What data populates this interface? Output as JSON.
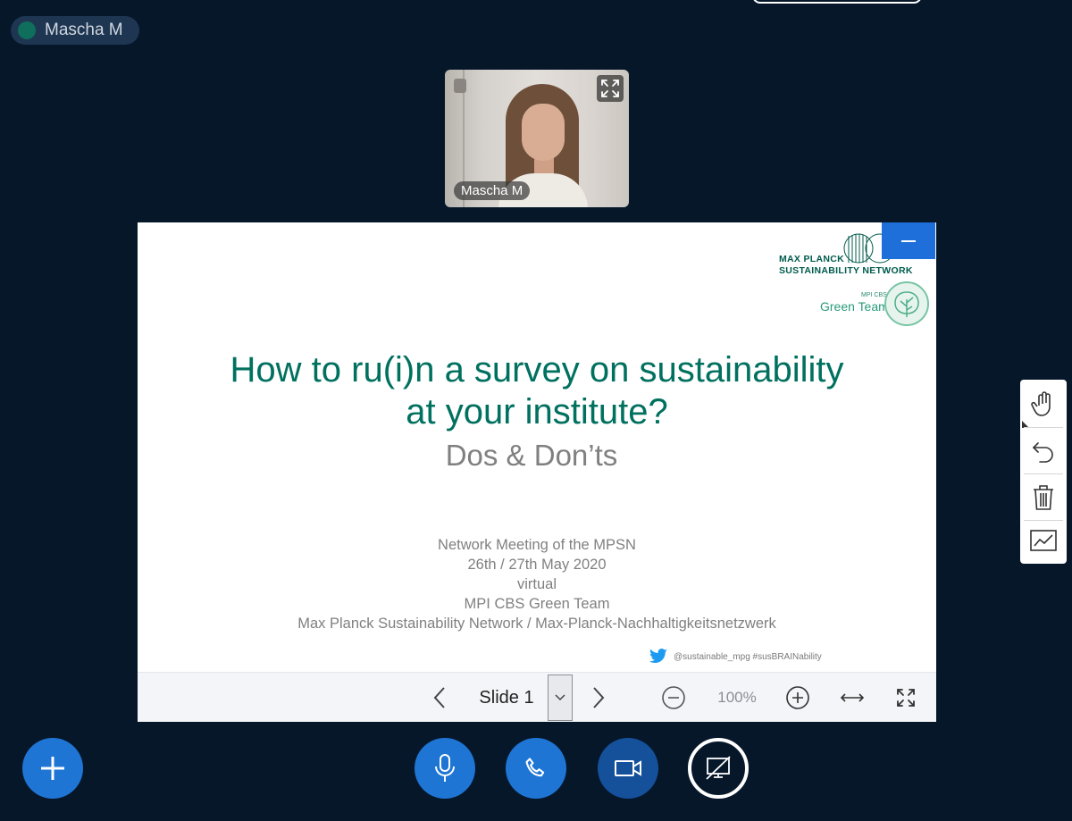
{
  "header": {
    "user_pill_name": "Mascha M"
  },
  "webcam": {
    "label": "Mascha M",
    "expand_icon": "expand-arrows-icon"
  },
  "slide": {
    "logo_line1": "MAX PLANCK",
    "logo_line2": "SUSTAINABILITY NETWORK",
    "green_team_small": "MPI CBS",
    "green_team": "Green Team",
    "title_line1": "How to ru(i)n a survey on sustainability",
    "title_line2": "at your institute?",
    "subtitle": "Dos & Don’ts",
    "info_lines": [
      "Network Meeting of the MPSN",
      "26th / 27th May 2020",
      "virtual",
      "MPI CBS Green Team",
      "Max Planck Sustainability Network / Max-Planck-Nachhaltigkeitsnetzwerk"
    ],
    "twitter_text": "@sustainable_mpg #susBRAINability",
    "colors": {
      "title": "#00705f",
      "grey_text": "#808080"
    }
  },
  "toolbar": {
    "slide_label": "Slide 1",
    "zoom_value": "100%"
  },
  "tools": [
    "hand-icon",
    "undo-icon",
    "trash-icon",
    "annotation-chart-icon"
  ],
  "controls": {
    "accent": "#1e75d4",
    "items": [
      "add-icon",
      "microphone-icon",
      "phone-icon",
      "video-camera-icon",
      "screen-share-icon"
    ]
  }
}
